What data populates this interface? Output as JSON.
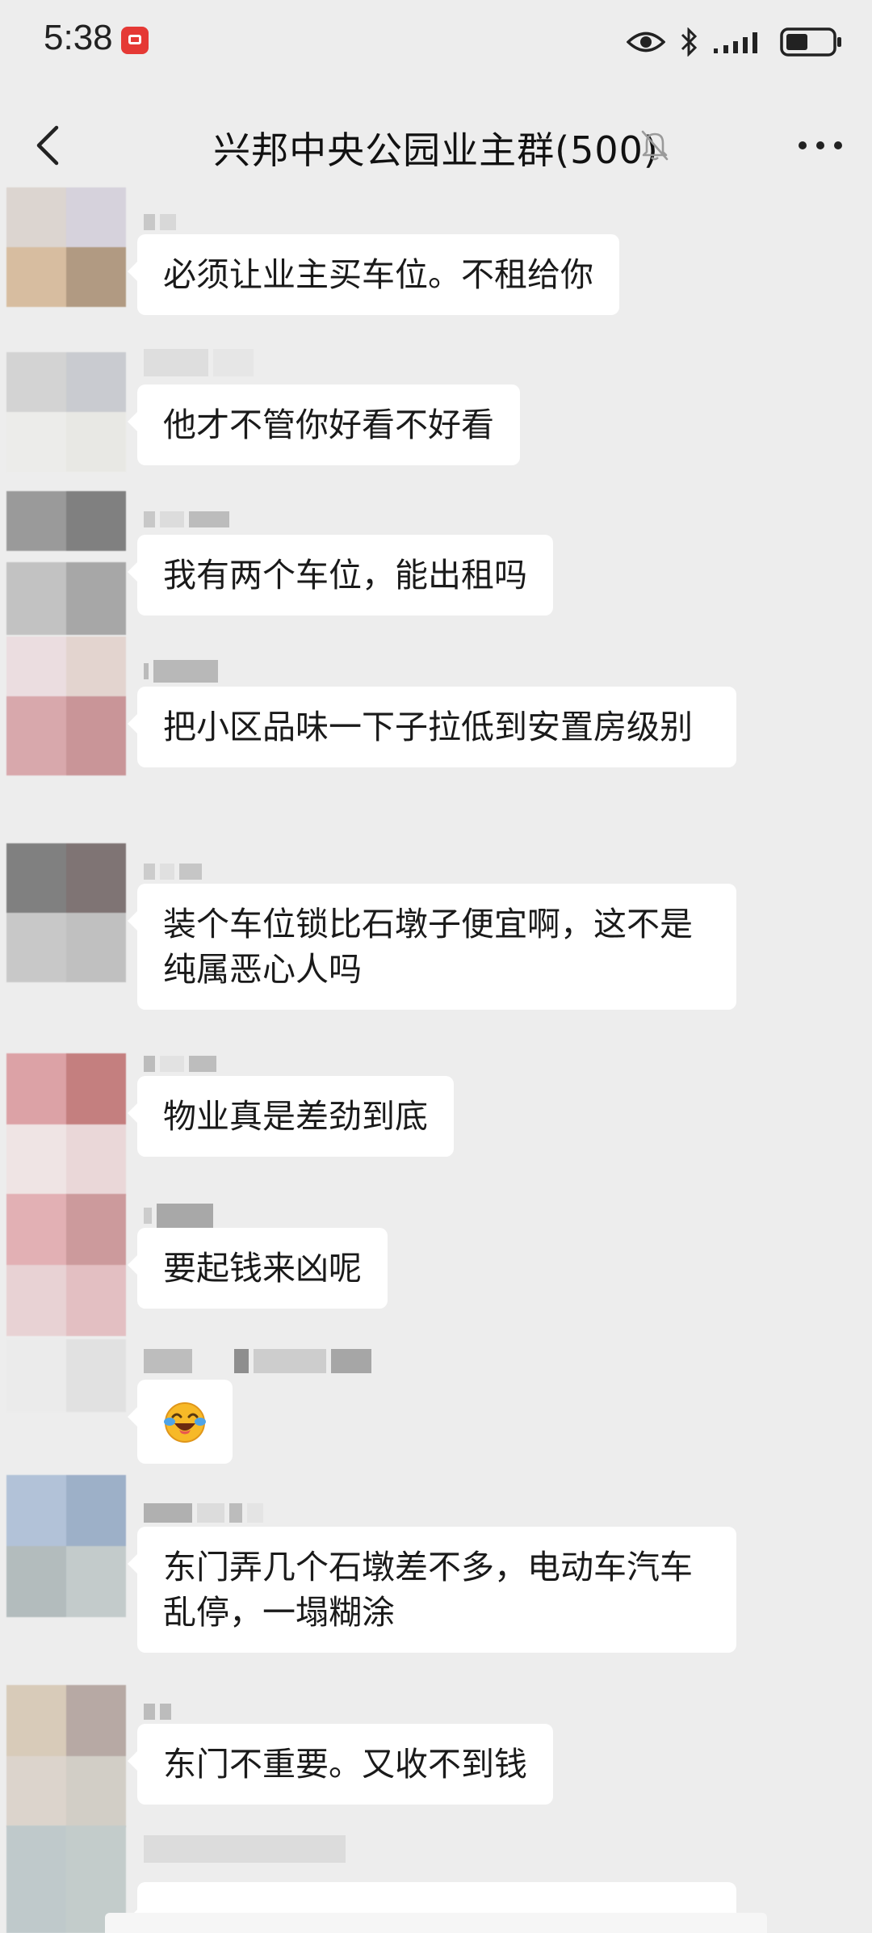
{
  "status_bar": {
    "time": "5:38"
  },
  "header": {
    "title": "兴邦中央公园业主群(500)"
  },
  "messages": [
    {
      "text": "必须让业主买车位。不租给你"
    },
    {
      "text": "他才不管你好看不好看"
    },
    {
      "text": "我有两个车位，能出租吗"
    },
    {
      "text": "把小区品味一下子拉低到安置房级别"
    },
    {
      "text": "装个车位锁比石墩子便宜啊，这不是纯属恶心人吗"
    },
    {
      "text": "物业真是差劲到底"
    },
    {
      "text": "要起钱来凶呢"
    },
    {
      "text": "",
      "icon": "crying-laughing-emoji-icon"
    },
    {
      "text": "东门弄几个石墩差不多，电动车汽车乱停，一塌糊涂"
    },
    {
      "text": "东门不重要。又收不到钱"
    }
  ],
  "colors": {
    "background": "#ededed",
    "bubble": "#ffffff",
    "text": "#1a1a1a"
  }
}
